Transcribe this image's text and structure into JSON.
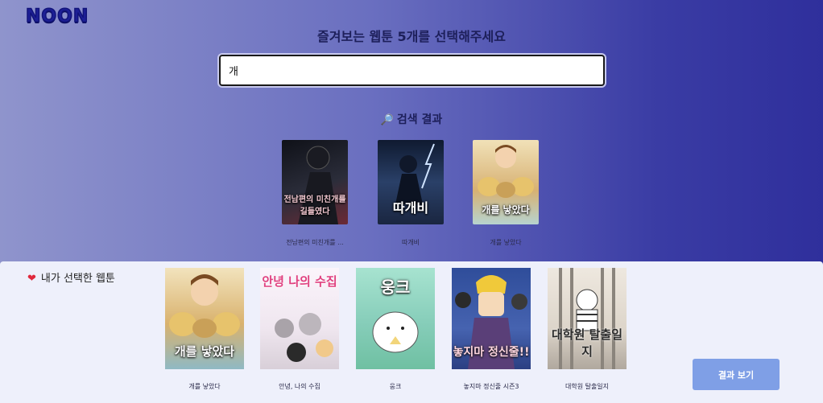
{
  "logo": "NOON",
  "prompt": "즐겨보는 웹툰 5개를 선택해주세요",
  "search": {
    "value": "개",
    "placeholder": ""
  },
  "results": {
    "title": "검색 결과",
    "icon": "magnifier-icon",
    "items": [
      {
        "name": "전남편의 미친개를 ...",
        "cover_text": "전남편의 미친개를 길들였다",
        "colors": [
          "#1d1f28",
          "#7b2f3a"
        ]
      },
      {
        "name": "따개비",
        "cover_text": "따개비",
        "colors": [
          "#1c2a44",
          "#4c6a9a"
        ]
      },
      {
        "name": "개를 낳았다",
        "cover_text": "개를 낳았다",
        "colors": [
          "#e6c27a",
          "#9fc5c8"
        ]
      }
    ]
  },
  "selected": {
    "title": "내가 선택한 웹툰",
    "icon": "heart-icon",
    "items": [
      {
        "name": "개를 낳았다",
        "cover_text": "개를 낳았다",
        "colors": [
          "#d9b26e",
          "#8fb9c4"
        ]
      },
      {
        "name": "안녕, 나의 수집",
        "cover_text": "안녕 나의 수집",
        "colors": [
          "#f3e9f3",
          "#cfc4cf"
        ]
      },
      {
        "name": "웅크",
        "cover_text": "웅크",
        "colors": [
          "#a8e0ce",
          "#7cc7b4"
        ]
      },
      {
        "name": "놓지마 정신줄 시즌3",
        "cover_text": "놓지마 정신줄!!",
        "colors": [
          "#3d5aa6",
          "#c9a23e"
        ]
      },
      {
        "name": "대학원 탈출일지",
        "cover_text": "대학원 탈출일지",
        "colors": [
          "#e9e3da",
          "#a39c93"
        ]
      }
    ]
  },
  "button": {
    "label": "결과 보기"
  }
}
